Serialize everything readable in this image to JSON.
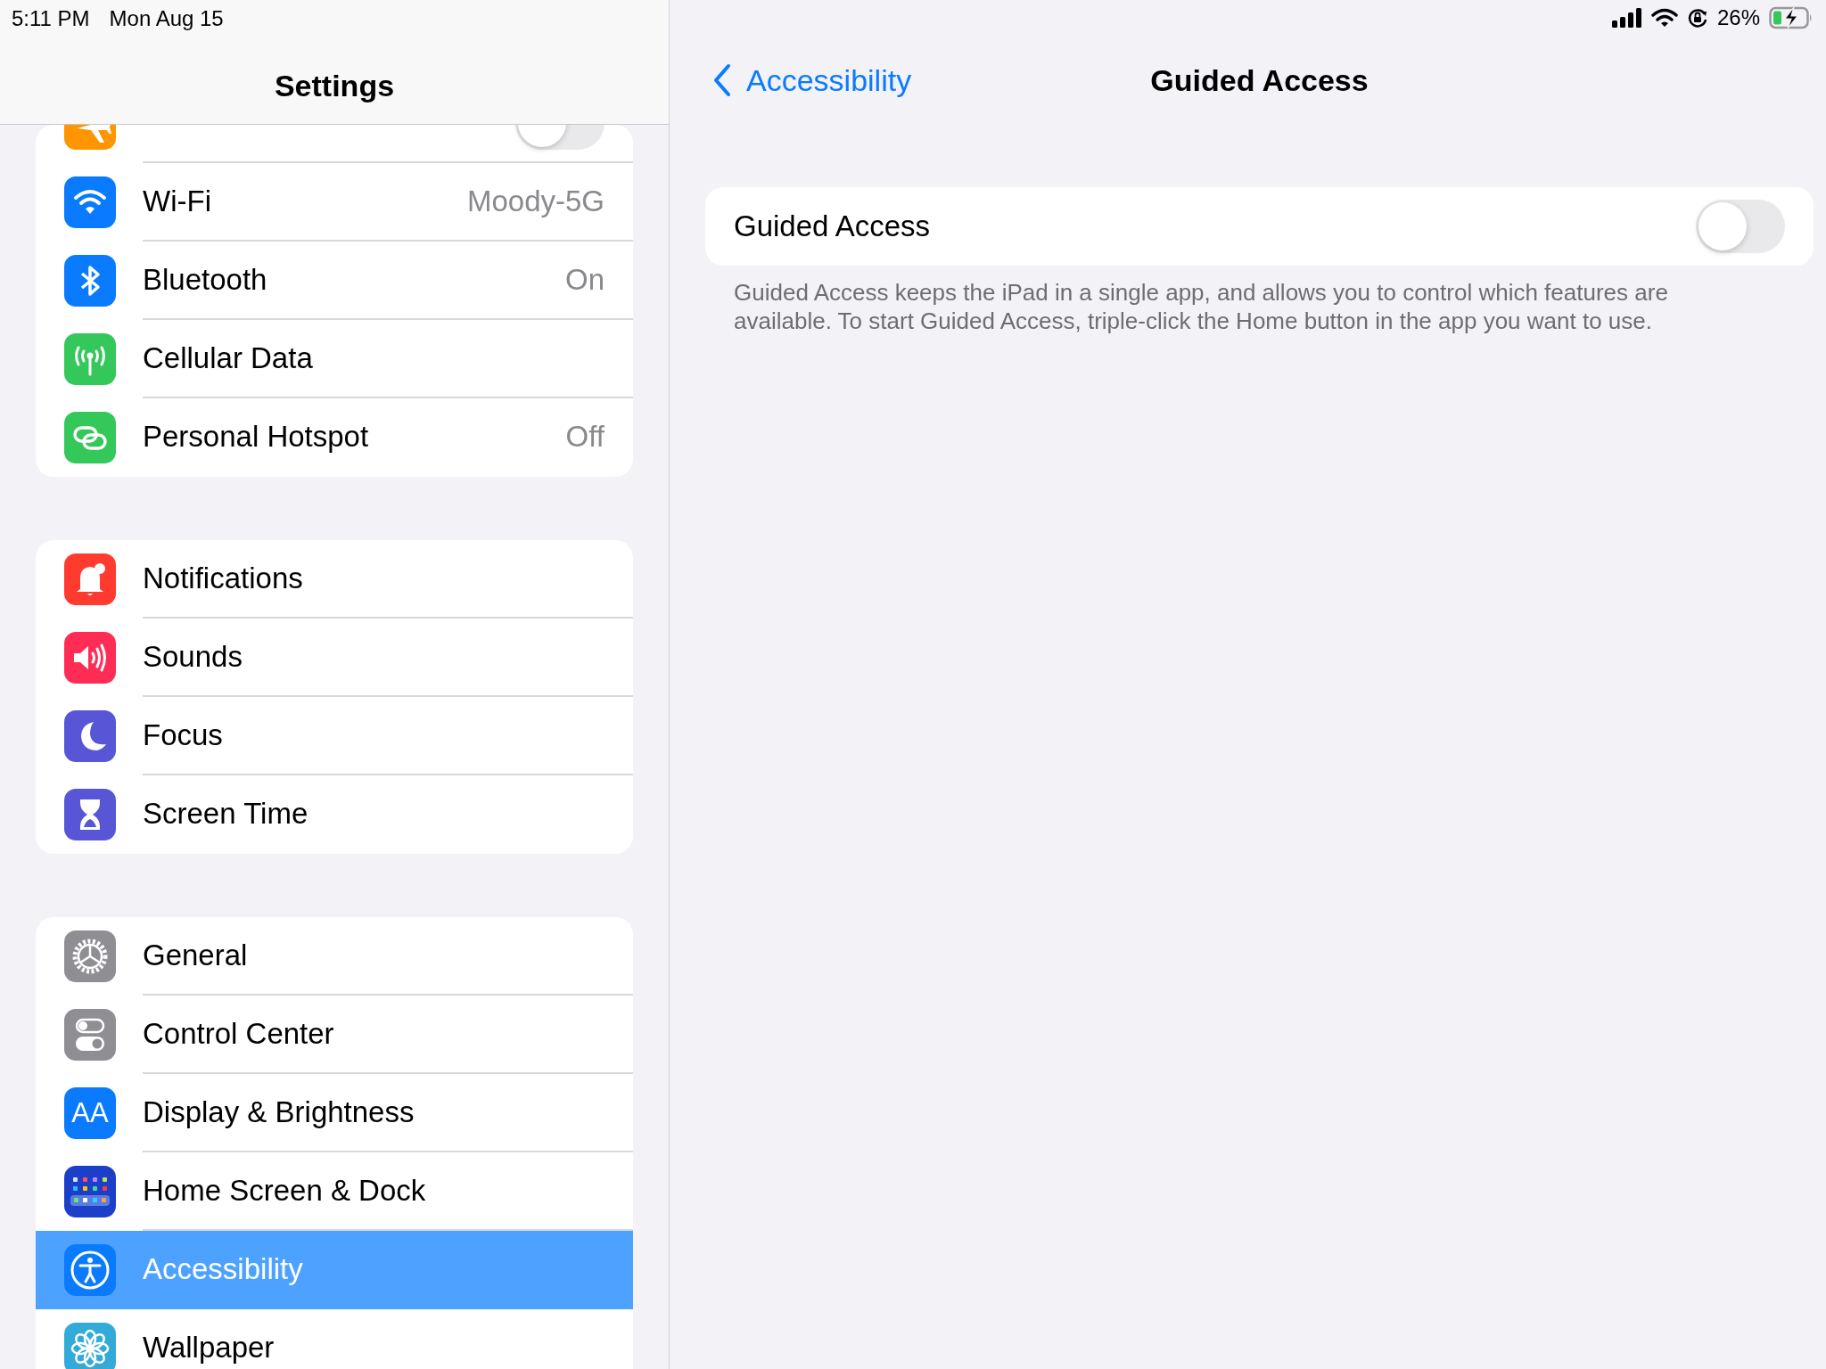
{
  "status_bar": {
    "time": "5:11 PM",
    "date": "Mon Aug 15",
    "battery": "26%"
  },
  "sidebar": {
    "title": "Settings",
    "groups": [
      {
        "rows": [
          {
            "kind": "toggle",
            "on": false,
            "color": "#ff9500",
            "selected": false
          },
          {
            "label": "Wi-Fi",
            "kind": "value",
            "value": "Moody-5G",
            "color": "#0a7aff",
            "selected": false
          },
          {
            "label": "Bluetooth",
            "kind": "value",
            "value": "On",
            "color": "#0a7aff",
            "selected": false
          },
          {
            "label": "Cellular Data",
            "kind": "plain",
            "color": "#34c759",
            "selected": false
          },
          {
            "label": "Personal Hotspot",
            "kind": "value",
            "value": "Off",
            "color": "#34c759",
            "selected": false
          }
        ]
      },
      {
        "rows": [
          {
            "label": "Notifications",
            "kind": "plain",
            "color": "#ff3b30",
            "selected": false
          },
          {
            "label": "Sounds",
            "kind": "plain",
            "color": "#ff2d55",
            "selected": false
          },
          {
            "label": "Focus",
            "kind": "plain",
            "color": "#5856d6",
            "selected": false
          },
          {
            "label": "Screen Time",
            "kind": "plain",
            "color": "#5856d6",
            "selected": false
          }
        ]
      },
      {
        "rows": [
          {
            "label": "General",
            "kind": "plain",
            "color": "#8e8e93",
            "selected": false
          },
          {
            "label": "Control Center",
            "kind": "plain",
            "color": "#8e8e93",
            "selected": false
          },
          {
            "label": "Display & Brightness",
            "kind": "plain",
            "icon_text": "AA",
            "color": "#0a7aff",
            "selected": false
          },
          {
            "label": "Home Screen & Dock",
            "kind": "plain",
            "color": "#1c3fc9",
            "selected": false
          },
          {
            "label": "Accessibility",
            "kind": "plain",
            "color": "#0a7aff",
            "selected": true
          },
          {
            "label": "Wallpaper",
            "kind": "plain",
            "color": "#33aad8",
            "selected": false
          }
        ]
      }
    ]
  },
  "detail": {
    "back": "Accessibility",
    "title": "Guided Access",
    "setting": {
      "label": "Guided Access",
      "on": false
    },
    "footnote": "Guided Access keeps the iPad in a single app, and allows you to control which features are available. To start Guided Access, triple-click the Home button in the app you want to use."
  }
}
